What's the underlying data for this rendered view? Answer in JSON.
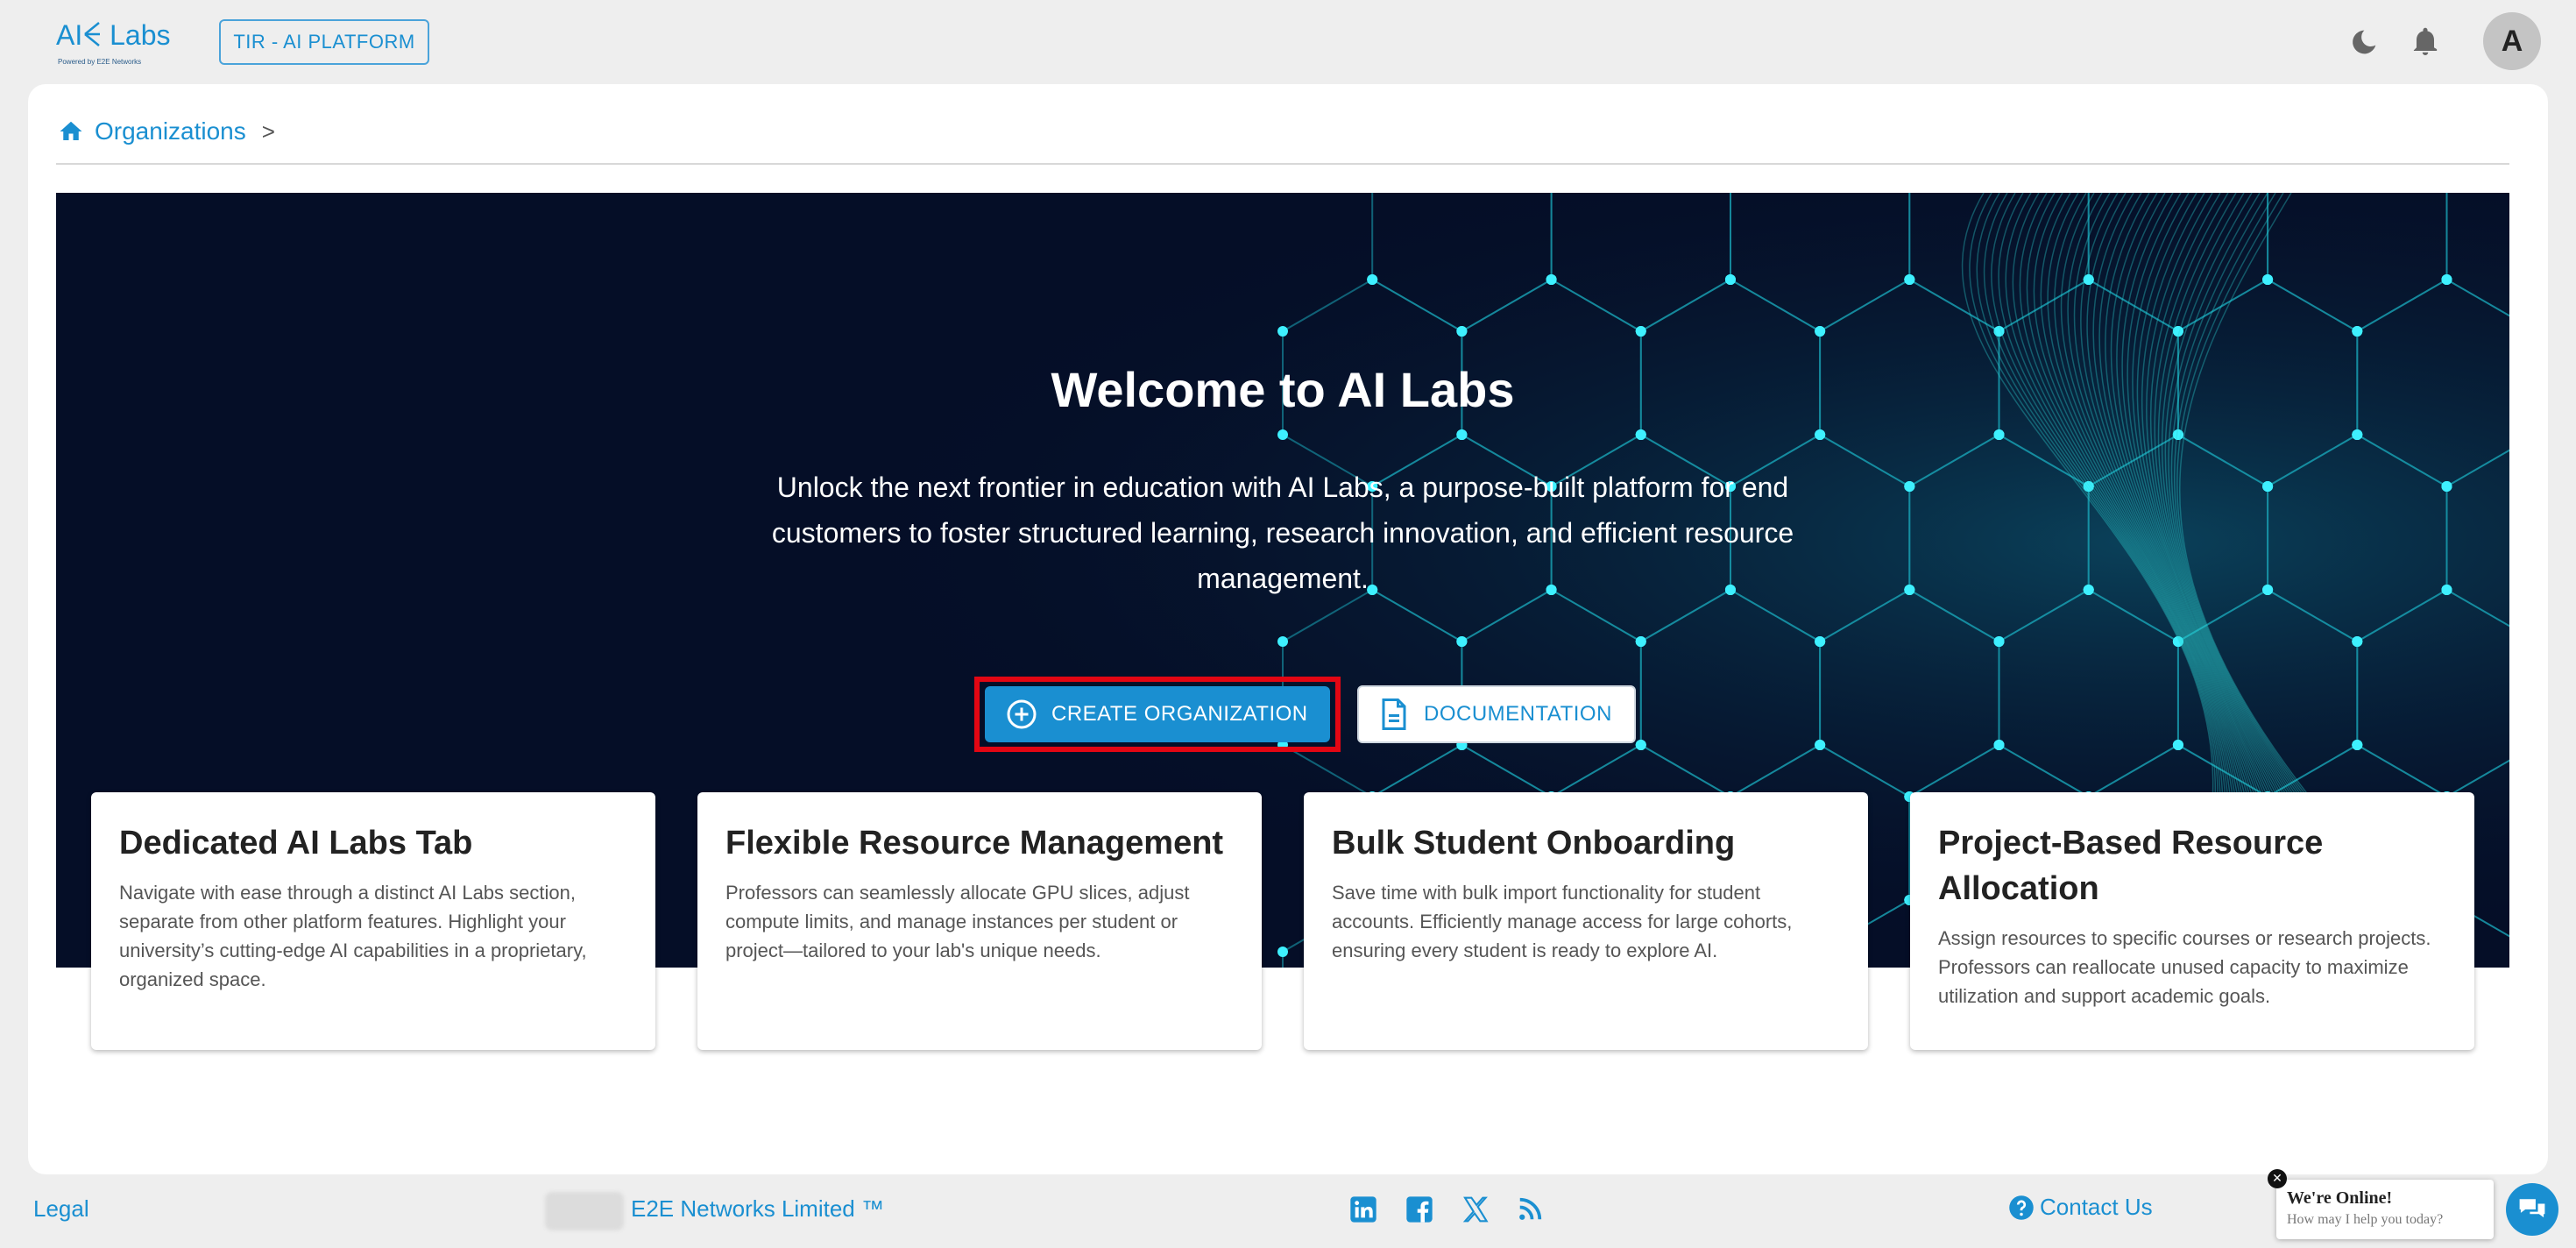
{
  "header": {
    "logo_text": "AI",
    "logo_text2": "Labs",
    "logo_sub": "Powered by E2E Networks",
    "platform_label": "TIR - AI PLATFORM",
    "avatar_initial": "A"
  },
  "breadcrumb": {
    "home_label": "Organizations",
    "separator": ">"
  },
  "hero": {
    "title": "Welcome to AI Labs",
    "description": "Unlock the next frontier in education with AI Labs, a purpose-built platform for end customers to foster structured learning, research innovation, and efficient resource management.",
    "create_label": "CREATE ORGANIZATION",
    "doc_label": "DOCUMENTATION"
  },
  "features": [
    {
      "title": "Dedicated AI Labs Tab",
      "text": "Navigate with ease through a distinct AI Labs section, separate from other platform features. Highlight your university’s cutting-edge AI capabilities in a proprietary, organized space."
    },
    {
      "title": "Flexible Resource Management",
      "text": "Professors can seamlessly allocate GPU slices, adjust compute limits, and manage instances per student or project—tailored to your lab's unique needs."
    },
    {
      "title": "Bulk Student Onboarding",
      "text": "Save time with bulk import functionality for student accounts. Efficiently manage access for large cohorts, ensuring every student is ready to explore AI."
    },
    {
      "title": "Project-Based Resource Allocation",
      "text": "Assign resources to specific courses or research projects. Professors can reallocate unused capacity to maximize utilization and support academic goals."
    }
  ],
  "footer": {
    "legal": "Legal",
    "company": "E2E Networks Limited ™",
    "social": [
      "linkedin-icon",
      "facebook-icon",
      "x-icon",
      "rss-icon"
    ],
    "contact": "Contact Us"
  },
  "chat": {
    "title": "We're Online!",
    "subtitle": "How may I help you today?",
    "close": "✕"
  },
  "colors": {
    "accent": "#1a8fd1",
    "hero_bg": "#050e27",
    "highlight": "#e30613"
  }
}
